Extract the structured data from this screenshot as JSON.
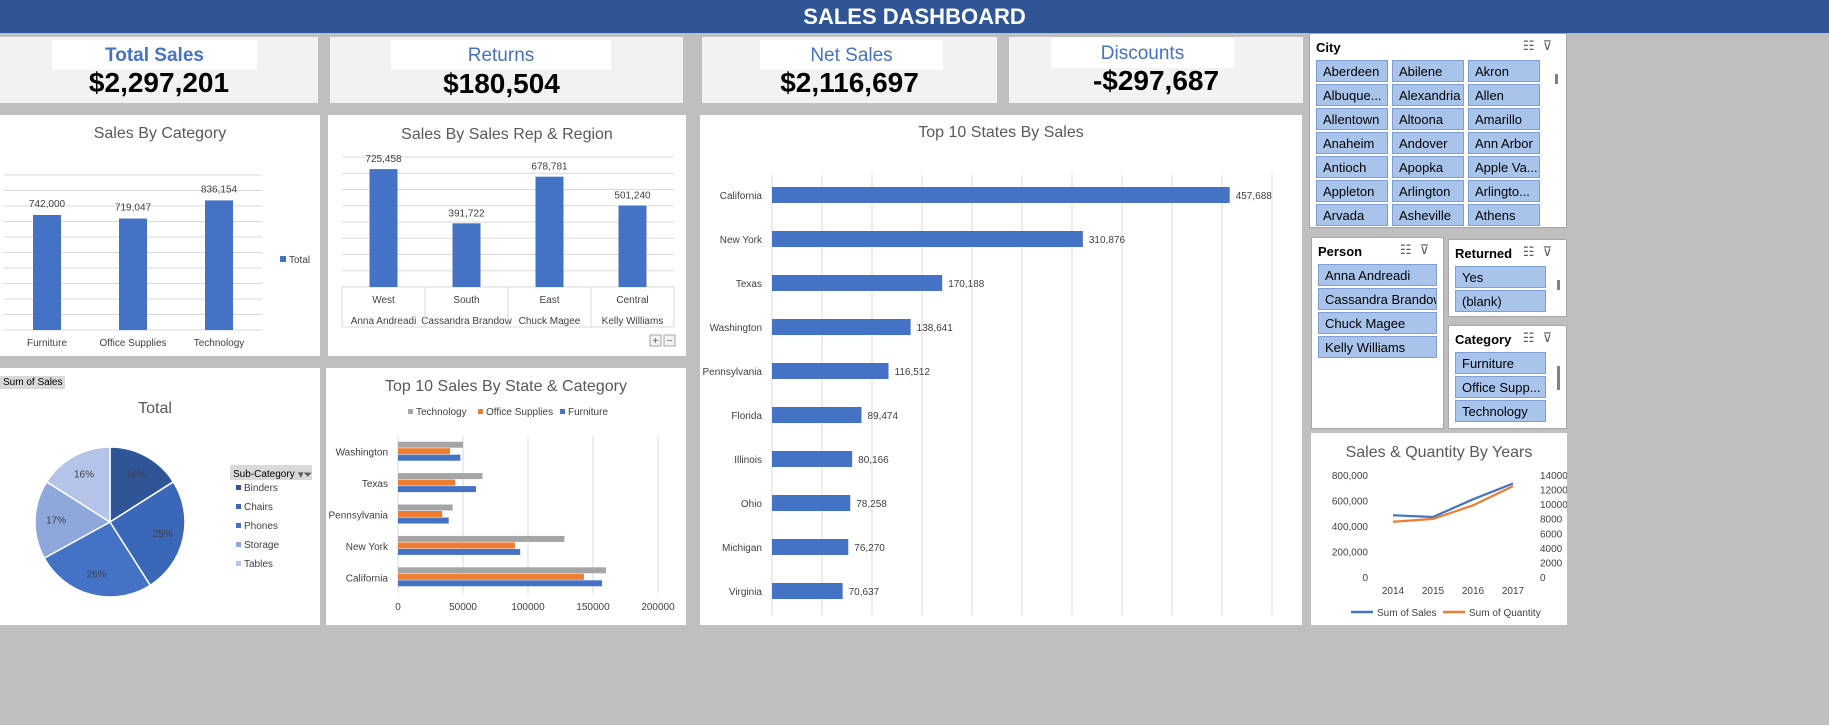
{
  "header": {
    "title": "SALES DASHBOARD"
  },
  "kpis": [
    {
      "label": "Total Sales",
      "value": "$2,297,201"
    },
    {
      "label": "Returns",
      "value": "$180,504"
    },
    {
      "label": "Net Sales",
      "value": "$2,116,697"
    },
    {
      "label": "Discounts",
      "value": "-$297,687"
    }
  ],
  "chart_data": [
    {
      "type": "bar",
      "title": "Sales By Category",
      "categories": [
        "Furniture",
        "Office Supplies",
        "Technology"
      ],
      "values": [
        742000,
        719047,
        836154
      ],
      "value_labels": [
        "742,000",
        "719,047",
        "836,154"
      ],
      "legend": [
        "Total"
      ],
      "color": "#4472c4"
    },
    {
      "type": "bar",
      "title": "Sales By Sales Rep & Region",
      "categories": [
        "West",
        "South",
        "East",
        "Central"
      ],
      "subcategories": [
        "Anna Andreadi",
        "Cassandra Brandow",
        "Chuck Magee",
        "Kelly Williams"
      ],
      "values": [
        725458,
        391722,
        678781,
        501240
      ],
      "value_labels": [
        "725,458",
        "391,722",
        "678,781",
        "501,240"
      ],
      "color": "#4472c4"
    },
    {
      "type": "pie",
      "title": "Total",
      "field_button": "Sum of Sales",
      "legend_title": "Sub-Category",
      "categories": [
        "Binders",
        "Chairs",
        "Phones",
        "Storage",
        "Tables"
      ],
      "values": [
        16,
        25,
        26,
        17,
        16
      ],
      "value_labels": [
        "16%",
        "25%",
        "26%",
        "17%",
        "16%"
      ],
      "colors": [
        "#2f5597",
        "#3a67b8",
        "#4472c4",
        "#8fa8dc",
        "#b4c4e8"
      ]
    },
    {
      "type": "bar",
      "orientation": "horizontal",
      "title": "Top 10 Sales By State & Category",
      "categories": [
        "Washington",
        "Texas",
        "Pennsylvania",
        "New York",
        "California"
      ],
      "series": [
        {
          "name": "Technology",
          "values": [
            50000,
            65000,
            42000,
            128000,
            160000
          ],
          "color": "#a5a5a5"
        },
        {
          "name": "Office Supplies",
          "values": [
            40000,
            44000,
            34000,
            90000,
            143000
          ],
          "color": "#ed7d31"
        },
        {
          "name": "Furniture",
          "values": [
            48000,
            60000,
            39000,
            94000,
            157000
          ],
          "color": "#4472c4"
        }
      ],
      "x_ticks": [
        "0",
        "50000",
        "100000",
        "150000",
        "200000"
      ],
      "xlim": [
        0,
        200000
      ]
    },
    {
      "type": "bar",
      "orientation": "horizontal",
      "title": "Top 10 States By Sales",
      "categories": [
        "California",
        "New York",
        "Texas",
        "Washington",
        "Pennsylvania",
        "Florida",
        "Illinois",
        "Ohio",
        "Michigan",
        "Virginia"
      ],
      "values": [
        457688,
        310876,
        170188,
        138641,
        116512,
        89474,
        80166,
        78258,
        76270,
        70637
      ],
      "value_labels": [
        "457,688",
        "310,876",
        "170,188",
        "138,641",
        "116,512",
        "89,474",
        "80,166",
        "78,258",
        "76,270",
        "70,637"
      ],
      "color": "#4472c4"
    },
    {
      "type": "line",
      "title": "Sales & Quantity By Years",
      "x": [
        "2014",
        "2015",
        "2016",
        "2017"
      ],
      "series": [
        {
          "name": "Sum of Sales",
          "values": [
            484247,
            470533,
            609206,
            733215
          ],
          "axis": "left",
          "color": "#4472c4"
        },
        {
          "name": "Sum of Quantity",
          "values": [
            7581,
            7979,
            9837,
            12476
          ],
          "axis": "right",
          "color": "#ed7d31"
        }
      ],
      "y_ticks_left": [
        "800,000",
        "600,000",
        "400,000",
        "200,000",
        "0"
      ],
      "y_ticks_right": [
        "14000",
        "12000",
        "10000",
        "8000",
        "6000",
        "4000",
        "2000",
        "0"
      ],
      "ylim_left": [
        0,
        800000
      ],
      "ylim_right": [
        0,
        14000
      ]
    }
  ],
  "slicers": {
    "city": {
      "title": "City",
      "items": [
        "Aberdeen",
        "Abilene",
        "Akron",
        "Albuque...",
        "Alexandria",
        "Allen",
        "Allentown",
        "Altoona",
        "Amarillo",
        "Anaheim",
        "Andover",
        "Ann Arbor",
        "Antioch",
        "Apopka",
        "Apple Va...",
        "Appleton",
        "Arlington",
        "Arlingto...",
        "Arvada",
        "Asheville",
        "Athens"
      ]
    },
    "person": {
      "title": "Person",
      "items": [
        "Anna Andreadi",
        "Cassandra Brandow",
        "Chuck Magee",
        "Kelly Williams"
      ]
    },
    "returned": {
      "title": "Returned",
      "items": [
        "Yes",
        "(blank)"
      ]
    },
    "category": {
      "title": "Category",
      "items": [
        "Furniture",
        "Office Supp...",
        "Technology"
      ]
    }
  },
  "icons": {
    "multi_select": "multi-select-icon",
    "clear_filter": "clear-filter-icon",
    "field_filter": "filter-dropdown-icon"
  }
}
